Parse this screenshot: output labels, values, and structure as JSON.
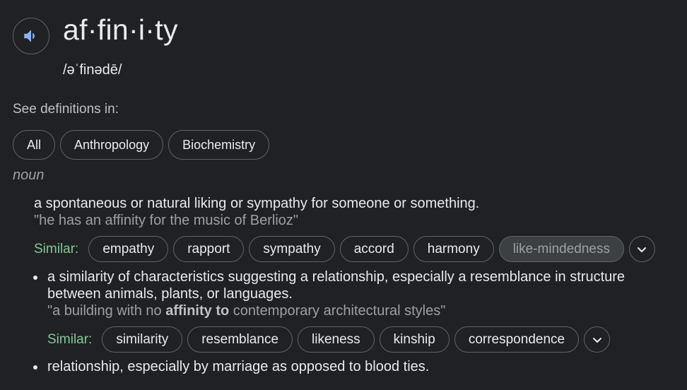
{
  "entry": {
    "word": "af·fin·i·ty",
    "phonetic": "/əˈfinədē/",
    "speaker_icon": "volume-icon"
  },
  "see_definitions": {
    "label": "See definitions in:",
    "chips": [
      "All",
      "Anthropology",
      "Biochemistry"
    ]
  },
  "part_of_speech": "noun",
  "senses": [
    {
      "definition": "a spontaneous or natural liking or sympathy for someone or something.",
      "example": "\"he has an affinity for the music of Berlioz\"",
      "similar_label": "Similar:",
      "similar": [
        "empathy",
        "rapport",
        "sympathy",
        "accord",
        "harmony",
        "like-mindedness"
      ],
      "highlighted_similar": "like-mindedness"
    },
    {
      "definition": "a similarity of characteristics suggesting a relationship, especially a resemblance in structure between animals, plants, or languages.",
      "example_before": "\"a building with no ",
      "example_bold": "affinity to",
      "example_after": " contemporary architectural styles\"",
      "similar_label": "Similar:",
      "similar": [
        "similarity",
        "resemblance",
        "likeness",
        "kinship",
        "correspondence"
      ]
    },
    {
      "definition": "relationship, especially by marriage as opposed to blood ties."
    }
  ],
  "colors": {
    "background": "#202124",
    "text": "#e8eaed",
    "muted": "#9aa0a6",
    "similar_label": "#81c995",
    "speaker_icon": "#8ab4f8",
    "chip_border": "#5f6368"
  }
}
